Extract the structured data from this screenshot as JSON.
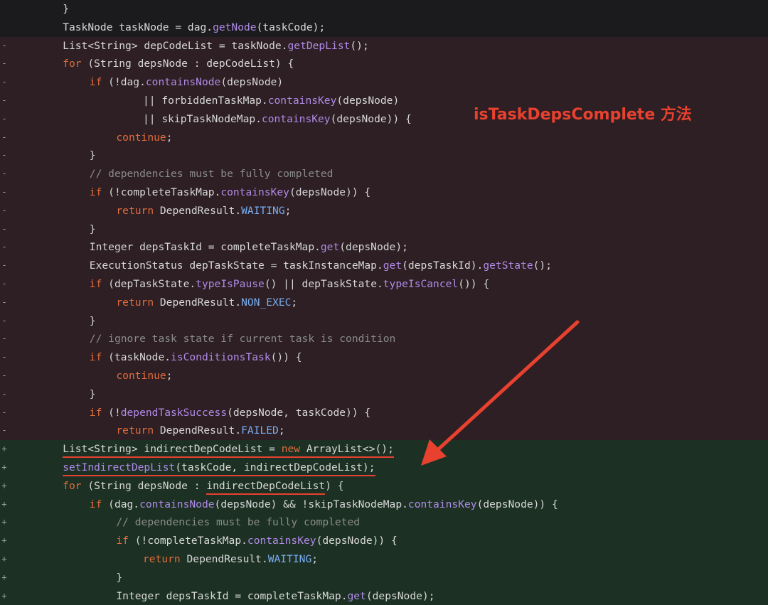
{
  "colors": {
    "ctx_bg": "#1b1b1d",
    "del_bg": "#2d1f23",
    "add_bg": "#1c3124",
    "keyword": "#e06c3e",
    "method": "#b18ae8",
    "constant": "#79aef2",
    "comment": "#8b8b8b",
    "annotation": "#e8412f"
  },
  "annotation": {
    "text": "isTaskDepsComplete 方法"
  },
  "diff_lines": [
    {
      "type": "ctx",
      "marker": "",
      "indent": 2,
      "tokens": [
        {
          "t": "}",
          "c": ""
        }
      ]
    },
    {
      "type": "ctx",
      "marker": "",
      "indent": 2,
      "tokens": [
        {
          "t": "TaskNode taskNode = dag.",
          "c": ""
        },
        {
          "t": "getNode",
          "c": "fn"
        },
        {
          "t": "(taskCode);",
          "c": ""
        }
      ]
    },
    {
      "type": "del",
      "marker": "-",
      "indent": 2,
      "tokens": [
        {
          "t": "List<String> depCodeList = taskNode.",
          "c": ""
        },
        {
          "t": "getDepList",
          "c": "fn"
        },
        {
          "t": "();",
          "c": ""
        }
      ]
    },
    {
      "type": "del",
      "marker": "-",
      "indent": 2,
      "tokens": [
        {
          "t": "for",
          "c": "kw"
        },
        {
          "t": " (String depsNode : depCodeList) {",
          "c": ""
        }
      ]
    },
    {
      "type": "del",
      "marker": "-",
      "indent": 3,
      "tokens": [
        {
          "t": "if",
          "c": "kw"
        },
        {
          "t": " (!dag.",
          "c": ""
        },
        {
          "t": "containsNode",
          "c": "fn"
        },
        {
          "t": "(depsNode)",
          "c": ""
        }
      ]
    },
    {
      "type": "del",
      "marker": "-",
      "indent": 5,
      "tokens": [
        {
          "t": "|| forbiddenTaskMap.",
          "c": ""
        },
        {
          "t": "containsKey",
          "c": "fn"
        },
        {
          "t": "(depsNode)",
          "c": ""
        }
      ]
    },
    {
      "type": "del",
      "marker": "-",
      "indent": 5,
      "tokens": [
        {
          "t": "|| skipTaskNodeMap.",
          "c": ""
        },
        {
          "t": "containsKey",
          "c": "fn"
        },
        {
          "t": "(depsNode)) {",
          "c": ""
        }
      ]
    },
    {
      "type": "del",
      "marker": "-",
      "indent": 4,
      "tokens": [
        {
          "t": "continue",
          "c": "kw"
        },
        {
          "t": ";",
          "c": ""
        }
      ]
    },
    {
      "type": "del",
      "marker": "-",
      "indent": 3,
      "tokens": [
        {
          "t": "}",
          "c": ""
        }
      ]
    },
    {
      "type": "del",
      "marker": "-",
      "indent": 3,
      "tokens": [
        {
          "t": "// dependencies must be fully completed",
          "c": "com"
        }
      ]
    },
    {
      "type": "del",
      "marker": "-",
      "indent": 3,
      "tokens": [
        {
          "t": "if",
          "c": "kw"
        },
        {
          "t": " (!completeTaskMap.",
          "c": ""
        },
        {
          "t": "containsKey",
          "c": "fn"
        },
        {
          "t": "(depsNode)) {",
          "c": ""
        }
      ]
    },
    {
      "type": "del",
      "marker": "-",
      "indent": 4,
      "tokens": [
        {
          "t": "return",
          "c": "kw"
        },
        {
          "t": " DependResult.",
          "c": ""
        },
        {
          "t": "WAITING",
          "c": "cst"
        },
        {
          "t": ";",
          "c": ""
        }
      ]
    },
    {
      "type": "del",
      "marker": "-",
      "indent": 3,
      "tokens": [
        {
          "t": "}",
          "c": ""
        }
      ]
    },
    {
      "type": "del",
      "marker": "-",
      "indent": 3,
      "tokens": [
        {
          "t": "Integer depsTaskId = completeTaskMap.",
          "c": ""
        },
        {
          "t": "get",
          "c": "fn"
        },
        {
          "t": "(depsNode);",
          "c": ""
        }
      ]
    },
    {
      "type": "del",
      "marker": "-",
      "indent": 3,
      "tokens": [
        {
          "t": "ExecutionStatus depTaskState = taskInstanceMap.",
          "c": ""
        },
        {
          "t": "get",
          "c": "fn"
        },
        {
          "t": "(depsTaskId).",
          "c": ""
        },
        {
          "t": "getState",
          "c": "fn"
        },
        {
          "t": "();",
          "c": ""
        }
      ]
    },
    {
      "type": "del",
      "marker": "-",
      "indent": 3,
      "tokens": [
        {
          "t": "if",
          "c": "kw"
        },
        {
          "t": " (depTaskState.",
          "c": ""
        },
        {
          "t": "typeIsPause",
          "c": "fn"
        },
        {
          "t": "() || depTaskState.",
          "c": ""
        },
        {
          "t": "typeIsCancel",
          "c": "fn"
        },
        {
          "t": "()) {",
          "c": ""
        }
      ]
    },
    {
      "type": "del",
      "marker": "-",
      "indent": 4,
      "tokens": [
        {
          "t": "return",
          "c": "kw"
        },
        {
          "t": " DependResult.",
          "c": ""
        },
        {
          "t": "NON_EXEC",
          "c": "cst"
        },
        {
          "t": ";",
          "c": ""
        }
      ]
    },
    {
      "type": "del",
      "marker": "-",
      "indent": 3,
      "tokens": [
        {
          "t": "}",
          "c": ""
        }
      ]
    },
    {
      "type": "del",
      "marker": "-",
      "indent": 3,
      "tokens": [
        {
          "t": "// ignore task state if current task is condition",
          "c": "com"
        }
      ]
    },
    {
      "type": "del",
      "marker": "-",
      "indent": 3,
      "tokens": [
        {
          "t": "if",
          "c": "kw"
        },
        {
          "t": " (taskNode.",
          "c": ""
        },
        {
          "t": "isConditionsTask",
          "c": "fn"
        },
        {
          "t": "()) {",
          "c": ""
        }
      ]
    },
    {
      "type": "del",
      "marker": "-",
      "indent": 4,
      "tokens": [
        {
          "t": "continue",
          "c": "kw"
        },
        {
          "t": ";",
          "c": ""
        }
      ]
    },
    {
      "type": "del",
      "marker": "-",
      "indent": 3,
      "tokens": [
        {
          "t": "}",
          "c": ""
        }
      ]
    },
    {
      "type": "del",
      "marker": "-",
      "indent": 3,
      "tokens": [
        {
          "t": "if",
          "c": "kw"
        },
        {
          "t": " (!",
          "c": ""
        },
        {
          "t": "dependTaskSuccess",
          "c": "fn"
        },
        {
          "t": "(depsNode, taskCode)) {",
          "c": ""
        }
      ]
    },
    {
      "type": "del",
      "marker": "-",
      "indent": 4,
      "tokens": [
        {
          "t": "return",
          "c": "kw"
        },
        {
          "t": " DependResult.",
          "c": ""
        },
        {
          "t": "FAILED",
          "c": "cst"
        },
        {
          "t": ";",
          "c": ""
        }
      ]
    },
    {
      "type": "add",
      "marker": "+",
      "indent": 2,
      "tokens": [
        {
          "t": "List<String> indirectDepCodeList = ",
          "c": "",
          "u": 1
        },
        {
          "t": "new",
          "c": "kw",
          "u": 1
        },
        {
          "t": " ArrayList<>();",
          "c": "",
          "u": 1
        }
      ]
    },
    {
      "type": "add",
      "marker": "+",
      "indent": 2,
      "tokens": [
        {
          "t": "setIndirectDepList",
          "c": "fn",
          "u": 1
        },
        {
          "t": "(taskCode, indirectDepCodeList);",
          "c": "",
          "u": 1
        }
      ]
    },
    {
      "type": "add",
      "marker": "+",
      "indent": 2,
      "tokens": [
        {
          "t": "for",
          "c": "kw"
        },
        {
          "t": " (String depsNode : ",
          "c": ""
        },
        {
          "t": "indirectDepCodeList",
          "c": "",
          "u": 1
        },
        {
          "t": ") {",
          "c": ""
        }
      ]
    },
    {
      "type": "add",
      "marker": "+",
      "indent": 3,
      "tokens": [
        {
          "t": "if",
          "c": "kw"
        },
        {
          "t": " (dag.",
          "c": ""
        },
        {
          "t": "containsNode",
          "c": "fn"
        },
        {
          "t": "(depsNode) && !skipTaskNodeMap.",
          "c": ""
        },
        {
          "t": "containsKey",
          "c": "fn"
        },
        {
          "t": "(depsNode)) {",
          "c": ""
        }
      ]
    },
    {
      "type": "add",
      "marker": "+",
      "indent": 4,
      "tokens": [
        {
          "t": "// dependencies must be fully completed",
          "c": "com"
        }
      ]
    },
    {
      "type": "add",
      "marker": "+",
      "indent": 4,
      "tokens": [
        {
          "t": "if",
          "c": "kw"
        },
        {
          "t": " (!completeTaskMap.",
          "c": ""
        },
        {
          "t": "containsKey",
          "c": "fn"
        },
        {
          "t": "(depsNode)) {",
          "c": ""
        }
      ]
    },
    {
      "type": "add",
      "marker": "+",
      "indent": 5,
      "tokens": [
        {
          "t": "return",
          "c": "kw"
        },
        {
          "t": " DependResult.",
          "c": ""
        },
        {
          "t": "WAITING",
          "c": "cst"
        },
        {
          "t": ";",
          "c": ""
        }
      ]
    },
    {
      "type": "add",
      "marker": "+",
      "indent": 4,
      "tokens": [
        {
          "t": "}",
          "c": ""
        }
      ]
    },
    {
      "type": "add",
      "marker": "+",
      "indent": 4,
      "tokens": [
        {
          "t": "Integer depsTaskId = completeTaskMap.",
          "c": ""
        },
        {
          "t": "get",
          "c": "fn"
        },
        {
          "t": "(depsNode);",
          "c": ""
        }
      ]
    }
  ]
}
